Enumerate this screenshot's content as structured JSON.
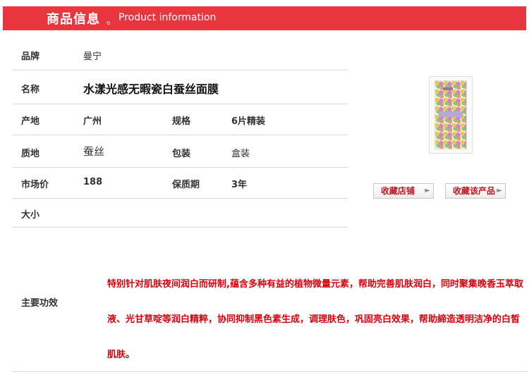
{
  "header": {
    "title_cn": "商品信息",
    "dot": "。",
    "title_en": "Product information"
  },
  "info": {
    "brand_label": "品牌",
    "brand_value": "曼宁",
    "name_label": "名称",
    "name_value": "水漾光感无暇瓷白蚕丝面膜",
    "origin_label": "产地",
    "origin_value": "广州",
    "spec_label": "规格",
    "spec_value": "6片精装",
    "material_label": "质地",
    "material_value": "蚕丝",
    "package_label": "包装",
    "package_value": "盒装",
    "price_label": "市场价",
    "price_value": "188",
    "shelf_label": "保质期",
    "shelf_value": "3年",
    "size_label": "大小",
    "size_value": ""
  },
  "buttons": {
    "fav_shop": "收藏店铺",
    "fav_product": "收藏该产品",
    "arrow": "►"
  },
  "effect": {
    "label": "主要功效",
    "text": "特别针对肌肤夜间润白而研制,蕴含多种有益的植物微量元素，帮助完善肌肤润白，同时聚集晚香玉萃取液、光甘草啶等润白精粹，协同抑制黑色素生成，调理肤色，巩固亮白效果，帮助締造透明洁净的白皙肌肤。"
  }
}
